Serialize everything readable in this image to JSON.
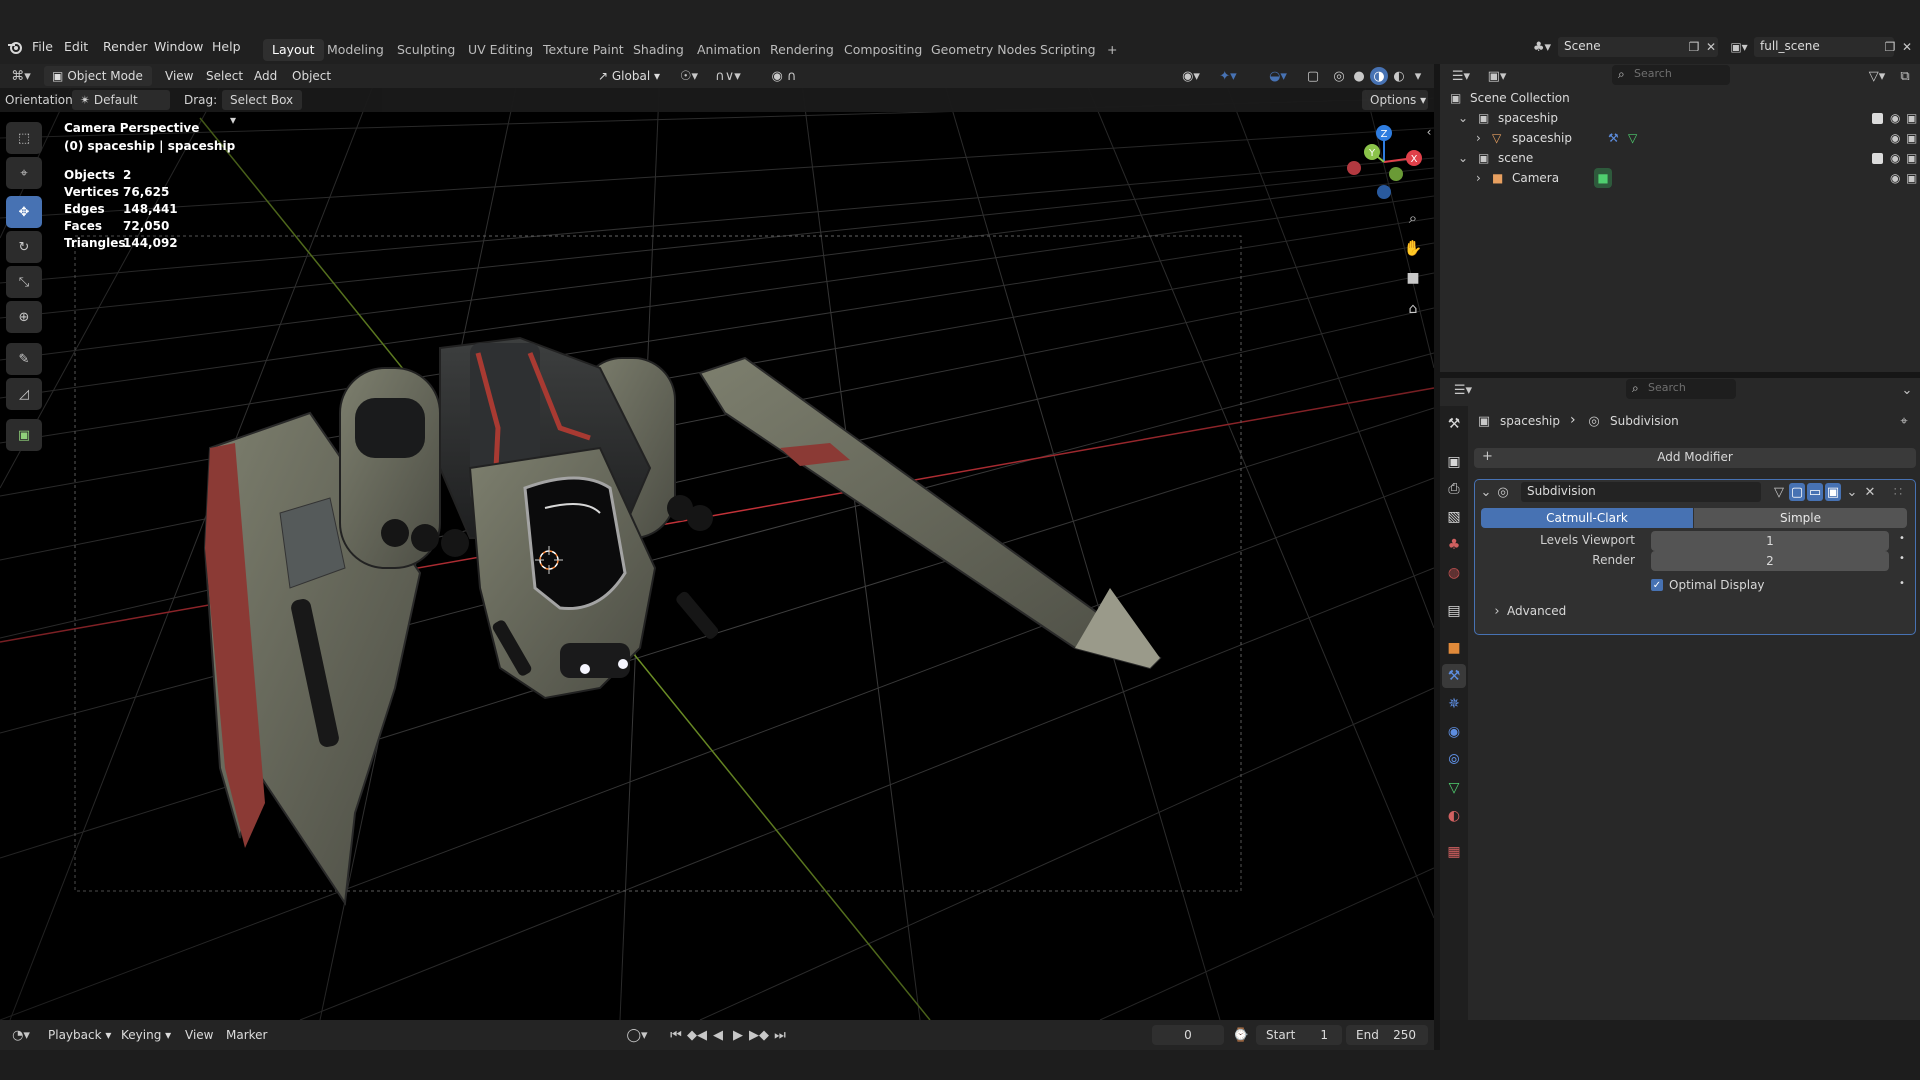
{
  "menus": {
    "file": "File",
    "edit": "Edit",
    "render": "Render",
    "window": "Window",
    "help": "Help"
  },
  "workspaces": [
    "Layout",
    "Modeling",
    "Sculpting",
    "UV Editing",
    "Texture Paint",
    "Shading",
    "Animation",
    "Rendering",
    "Compositing",
    "Geometry Nodes",
    "Scripting"
  ],
  "active_workspace": "Layout",
  "add_workspace": "+",
  "scene_selector": "Scene",
  "view_layer_selector": "full_scene",
  "viewport_header": {
    "mode": "Object Mode",
    "view": "View",
    "select": "Select",
    "add": "Add",
    "object": "Object",
    "transform_orientation": "Global",
    "orientation_label": "Orientation:",
    "orientation_value": "Default",
    "drag_label": "Drag:",
    "drag_value": "Select Box",
    "options": "Options"
  },
  "overlay_text": {
    "perspective": "Camera Perspective",
    "active_object": "(0) spaceship | spaceship"
  },
  "stats": {
    "objects_label": "Objects",
    "objects": "2",
    "vertices_label": "Vertices",
    "vertices": "76,625",
    "edges_label": "Edges",
    "edges": "148,441",
    "faces_label": "Faces",
    "faces": "72,050",
    "triangles_label": "Triangles",
    "triangles": "144,092"
  },
  "outliner": {
    "search_placeholder": "Search",
    "root": "Scene Collection",
    "items": [
      {
        "label": "spaceship",
        "kind": "collection"
      },
      {
        "label": "spaceship",
        "kind": "mesh"
      },
      {
        "label": "scene",
        "kind": "collection"
      },
      {
        "label": "Camera",
        "kind": "camera"
      }
    ]
  },
  "properties": {
    "search_placeholder": "Search",
    "breadcrumb_object": "spaceship",
    "breadcrumb_modifier": "Subdivision",
    "add_modifier": "Add Modifier",
    "modifier_name": "Subdivision",
    "catmull_clark": "Catmull-Clark",
    "simple": "Simple",
    "levels_viewport_label": "Levels Viewport",
    "levels_viewport": "1",
    "render_label": "Render",
    "render_value": "2",
    "optimal_display": "Optimal Display",
    "optimal_display_checked": true,
    "advanced": "Advanced"
  },
  "timeline": {
    "playback": "Playback",
    "keying": "Keying",
    "view": "View",
    "marker": "Marker",
    "current_frame": "0",
    "start_label": "Start",
    "start": "1",
    "end_label": "End",
    "end": "250"
  },
  "colors": {
    "accent": "#4772b3",
    "axis_x": "#c8333a",
    "axis_y": "#7aa12a",
    "background": "#000000"
  }
}
